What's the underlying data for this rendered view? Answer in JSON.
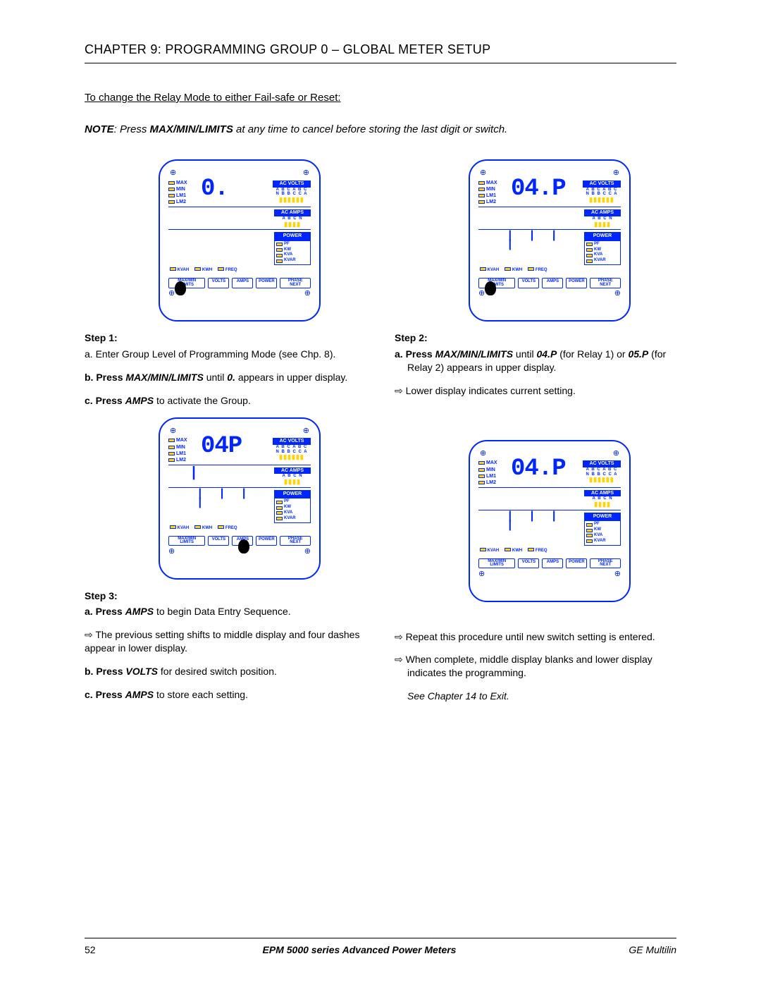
{
  "chapter_title": "CHAPTER 9: PROGRAMMING GROUP 0 – GLOBAL METER SETUP",
  "intro_line": "To change the Relay Mode to either Fail-safe or Reset:",
  "note": {
    "prefix": "NOTE",
    "body_before": ": Press ",
    "bold": "MAX/MIN/LIMITS",
    "body_after": " at any time to cancel before storing the last digit or switch."
  },
  "meter_labels": {
    "leds": [
      "MAX",
      "MIN",
      "LM1",
      "LM2"
    ],
    "ac_volts": "AC VOLTS",
    "volts_letters": "A B C A B C",
    "volts_letters2": "N B B C C A",
    "ac_amps": "AC AMPS",
    "amps_letters": "A B C N",
    "power": "POWER",
    "power_items": [
      "PF",
      "KW",
      "KVA",
      "KVAR"
    ],
    "status": [
      "KVAH",
      "KWH",
      "FREQ"
    ],
    "buttons": {
      "maxmin": "MAX/MIN\nLIMITS",
      "volts": "VOLTS",
      "amps": "AMPS",
      "power": "POWER",
      "phase": "PHASE\nNEXT"
    }
  },
  "meters": {
    "step1": {
      "top_reading": "0.",
      "mid_reading": "",
      "low_reading": "",
      "cursor_on": "maxmin"
    },
    "step2": {
      "top_reading": "04.P",
      "mid_reading": "",
      "low_reading": "| | | |",
      "cursor_on": "maxmin"
    },
    "step3": {
      "top_reading": "04P",
      "mid_reading": "|",
      "low_reading": "| | | |",
      "cursor_on": "amps",
      "dash_mid": true
    },
    "step4": {
      "top_reading": "04.P",
      "mid_reading": "",
      "low_reading": "| | | |",
      "cursor_on": "none"
    }
  },
  "steps": {
    "s1": {
      "title": "Step 1:",
      "a": "a. Enter Group Level of Programming Mode (see Chp. 8).",
      "b_pre": "b. Press ",
      "b_bold": "MAX/MIN/LIMITS",
      "b_post": " until ",
      "b_ital": "0.",
      "b_end": " appears in upper display.",
      "c_pre": "c.  Press ",
      "c_bold": "AMPS",
      "c_post": "  to activate the Group."
    },
    "s2": {
      "title": "Step 2:",
      "a_pre": "a.    Press ",
      "a_bold": "MAX/MIN/LIMITS",
      "a_mid1": " until ",
      "a_b2": "04.P",
      "a_mid2": " (for Relay 1) or ",
      "a_b3": "05.P",
      "a_mid3": " (for Relay 2) appears in upper display.",
      "arrow": "⇨ Lower display indicates current setting."
    },
    "s3": {
      "title": "Step 3:",
      "a_pre": "a.  Press ",
      "a_bold": "AMPS",
      "a_post": " to begin Data Entry Sequence.",
      "arrow1": "⇨ The previous setting shifts to middle display and four dashes appear in lower display.",
      "b_pre": "b. Press ",
      "b_bold": "VOLTS",
      "b_post": "  for desired switch position.",
      "c_pre": "c.  Press ",
      "c_bold": "AMPS",
      "c_post": "  to store each setting."
    },
    "s4": {
      "arrow1": "⇨ Repeat this procedure until new switch setting is entered.",
      "arrow2": "⇨ When complete, middle display blanks and lower display indicates the programming.",
      "exit": "See Chapter 14 to Exit."
    }
  },
  "footer": {
    "page": "52",
    "center": "EPM 5000 series Advanced Power Meters",
    "right": "GE Multilin"
  }
}
